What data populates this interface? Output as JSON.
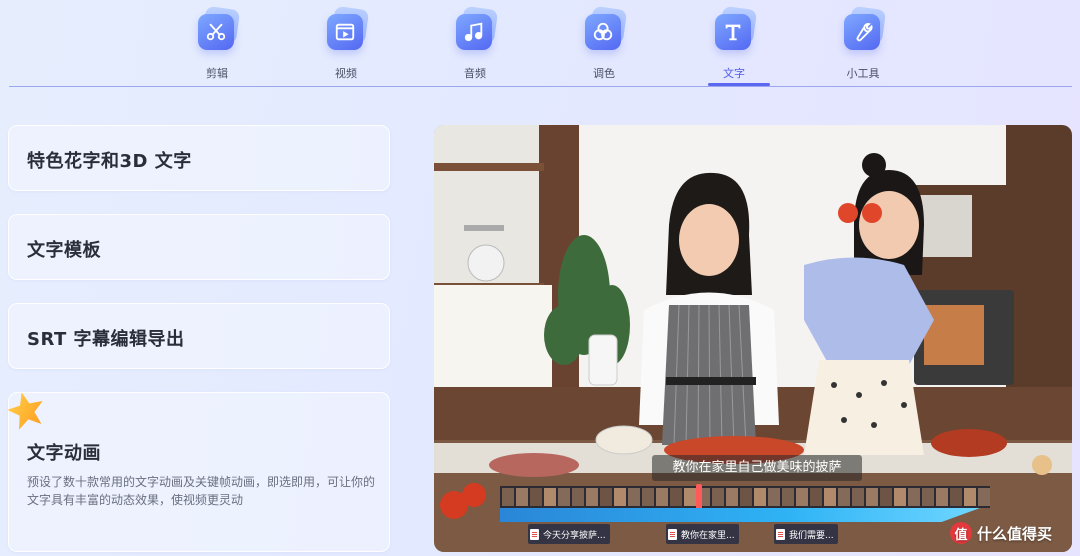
{
  "nav": {
    "tabs": [
      {
        "label": "剪辑",
        "icon": "scissors-icon"
      },
      {
        "label": "视频",
        "icon": "video-play-icon"
      },
      {
        "label": "音频",
        "icon": "music-note-icon"
      },
      {
        "label": "调色",
        "icon": "color-palette-icon"
      },
      {
        "label": "文字",
        "icon": "text-t-icon"
      },
      {
        "label": "小工具",
        "icon": "wrench-icon"
      }
    ],
    "active": "文字"
  },
  "features": [
    {
      "title": "特色花字和3D 文字"
    },
    {
      "title": "文字模板"
    },
    {
      "title": "SRT 字幕编辑导出"
    },
    {
      "title": "文字动画",
      "description": "预设了数十款常用的文字动画及关键帧动画，即选即用，可让你的文字具有丰富的动态效果，使视频更灵动"
    }
  ],
  "preview": {
    "subtitle": "教你在家里自己做美味的披萨",
    "subtitle_clips": [
      "今天分享披萨...",
      "教你在家里...",
      "我们需要..."
    ],
    "watermark": "什么值得买",
    "watermark_logo": "值"
  },
  "colors": {
    "accent": "#5b67ee",
    "timeline_track": "#2fb3f5",
    "playhead": "#ff5a5a"
  }
}
